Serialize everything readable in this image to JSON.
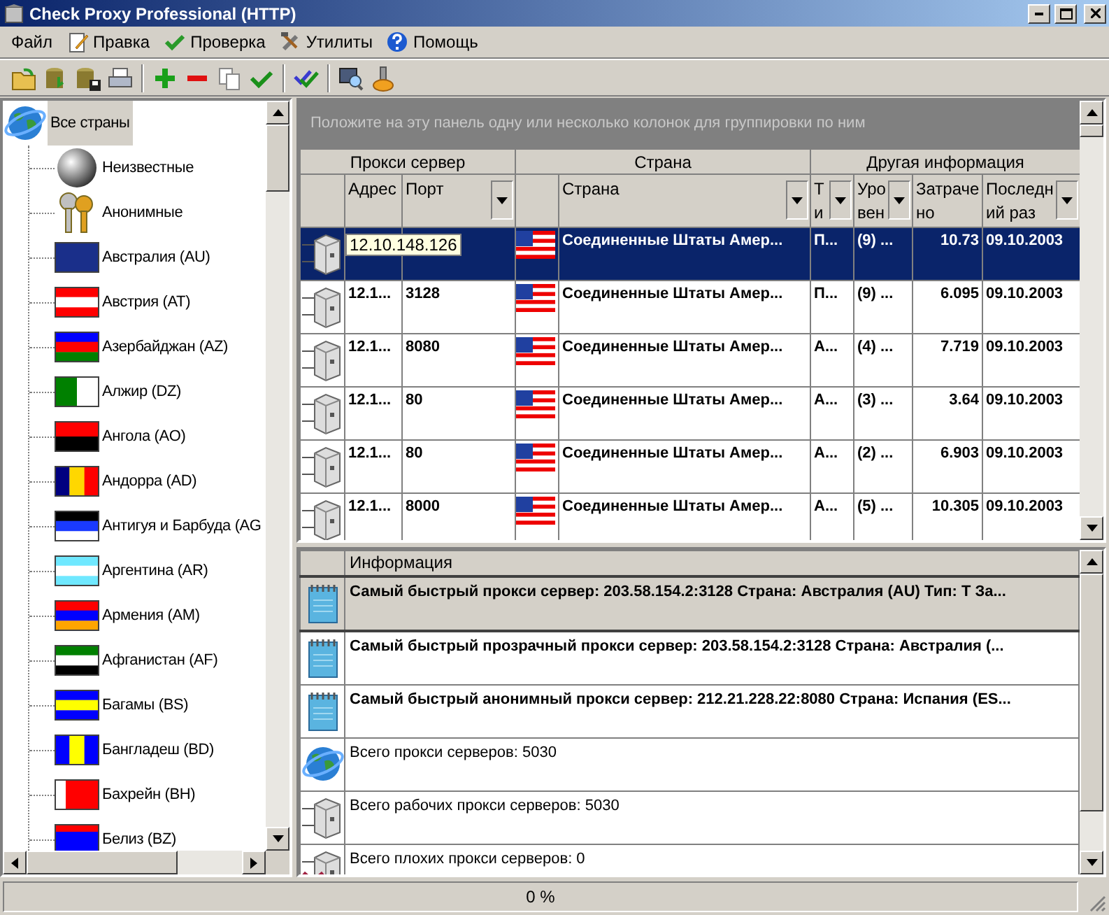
{
  "window": {
    "title": "Check Proxy Professional (HTTP)"
  },
  "menu": [
    {
      "label": "Файл",
      "kind": "text"
    },
    {
      "label": "Правка",
      "kind": "pencil"
    },
    {
      "label": "Проверка",
      "kind": "check"
    },
    {
      "label": "Утилиты",
      "kind": "tools"
    },
    {
      "label": "Помощь",
      "kind": "help"
    }
  ],
  "tree": {
    "items": [
      {
        "label": "Все страны",
        "kind": "globe",
        "selected": true,
        "children": [
          {
            "label": "Неизвестные",
            "kind": "ball",
            "selected": false
          },
          {
            "label": "Анонимные",
            "kind": "keys",
            "selected": false
          },
          {
            "label": "Австралия (AU)",
            "kind": "flag",
            "selected": false
          },
          {
            "label": "Австрия (AT)",
            "kind": "flag",
            "selected": false
          },
          {
            "label": "Азербайджан (AZ)",
            "kind": "flag",
            "selected": false
          },
          {
            "label": "Алжир (DZ)",
            "kind": "flag",
            "selected": false
          },
          {
            "label": "Ангола (AO)",
            "kind": "flag",
            "selected": false
          },
          {
            "label": "Андорра (AD)",
            "kind": "flag",
            "selected": false
          },
          {
            "label": "Антигуя и Барбуда (AG",
            "kind": "flag",
            "selected": false
          },
          {
            "label": "Аргентина (AR)",
            "kind": "flag",
            "selected": false
          },
          {
            "label": "Армения (AM)",
            "kind": "flag",
            "selected": false
          },
          {
            "label": "Афганистан (AF)",
            "kind": "flag",
            "selected": false
          },
          {
            "label": "Багамы (BS)",
            "kind": "flag",
            "selected": false
          },
          {
            "label": "Бангладеш (BD)",
            "kind": "flag",
            "selected": false
          },
          {
            "label": "Бахрейн (BH)",
            "kind": "flag",
            "selected": false
          },
          {
            "label": "Белиз (BZ)",
            "kind": "flag",
            "selected": false
          }
        ]
      }
    ]
  },
  "grid": {
    "group_hint": "Положите на эту панель одну или несколько колонок для группировки по ним",
    "groups": [
      {
        "label": "Прокси сервер",
        "columns": [
          {
            "filter": false
          },
          {
            "label": "Адрес",
            "filter": false
          },
          {
            "label": "Порт",
            "filter": true
          }
        ]
      },
      {
        "label": "Страна",
        "columns": [
          {
            "filter": false
          },
          {
            "label": "Страна",
            "filter": true
          }
        ]
      },
      {
        "label": "Другая информация",
        "columns": [
          {
            "label": "Т\nи",
            "filter": true
          },
          {
            "label": "Уро\nвен",
            "filter": true
          },
          {
            "label": "Затраче\nно",
            "filter": false
          },
          {
            "label": "Последн\nий раз",
            "filter": true
          }
        ]
      }
    ],
    "rows": [
      {
        "selected": true,
        "address_hint": true,
        "address": "12.10.148.126",
        "country": "Соединенные Штаты Амер...",
        "type": "П...",
        "level": "(9) ...",
        "time": "10.73",
        "date": "09.10.2003"
      },
      {
        "selected": false,
        "address_hint": false,
        "address": "12.1...",
        "port": "3128",
        "country": "Соединенные Штаты Амер...",
        "type": "П...",
        "level": "(9) ...",
        "time": "6.095",
        "date": "09.10.2003"
      },
      {
        "selected": false,
        "address_hint": false,
        "address": "12.1...",
        "port": "8080",
        "country": "Соединенные Штаты Амер...",
        "type": "А...",
        "level": "(4) ...",
        "time": "7.719",
        "date": "09.10.2003"
      },
      {
        "selected": false,
        "address_hint": false,
        "address": "12.1...",
        "port": "80",
        "country": "Соединенные Штаты Амер...",
        "type": "А...",
        "level": "(3) ...",
        "time": "3.64",
        "date": "09.10.2003"
      },
      {
        "selected": false,
        "address_hint": false,
        "address": "12.1...",
        "port": "80",
        "country": "Соединенные Штаты Амер...",
        "type": "А...",
        "level": "(2) ...",
        "time": "6.903",
        "date": "09.10.2003"
      },
      {
        "selected": false,
        "address_hint": false,
        "address": "12.1...",
        "port": "8000",
        "country": "Соединенные Штаты Амер...",
        "type": "А...",
        "level": "(5) ...",
        "time": "10.305",
        "date": "09.10.2003"
      }
    ]
  },
  "info": {
    "column": "Информация",
    "rows": [
      {
        "kind": "notepad",
        "bold": true,
        "selected": true,
        "text": "Самый быстрый прокси сервер: 203.58.154.2:3128 Страна: Австралия (AU) Тип: Т За..."
      },
      {
        "kind": "notepad",
        "bold": true,
        "selected": false,
        "text": "Самый быстрый прозрачный прокси сервер: 203.58.154.2:3128 Страна: Австралия (..."
      },
      {
        "kind": "notepad",
        "bold": true,
        "selected": false,
        "text": "Самый быстрый анонимный прокси сервер: 212.21.228.22:8080 Страна: Испания (ES..."
      },
      {
        "kind": "globe",
        "bold": false,
        "selected": false,
        "text": "Всего прокси серверов: 5030"
      },
      {
        "kind": "server",
        "bold": false,
        "selected": false,
        "text": "Всего рабочих прокси серверов: 5030"
      },
      {
        "kind": "server-bad",
        "bold": false,
        "selected": false,
        "text": "Всего плохих прокси серверов: 0"
      }
    ]
  },
  "status_bar": {
    "progress": "0 %"
  }
}
